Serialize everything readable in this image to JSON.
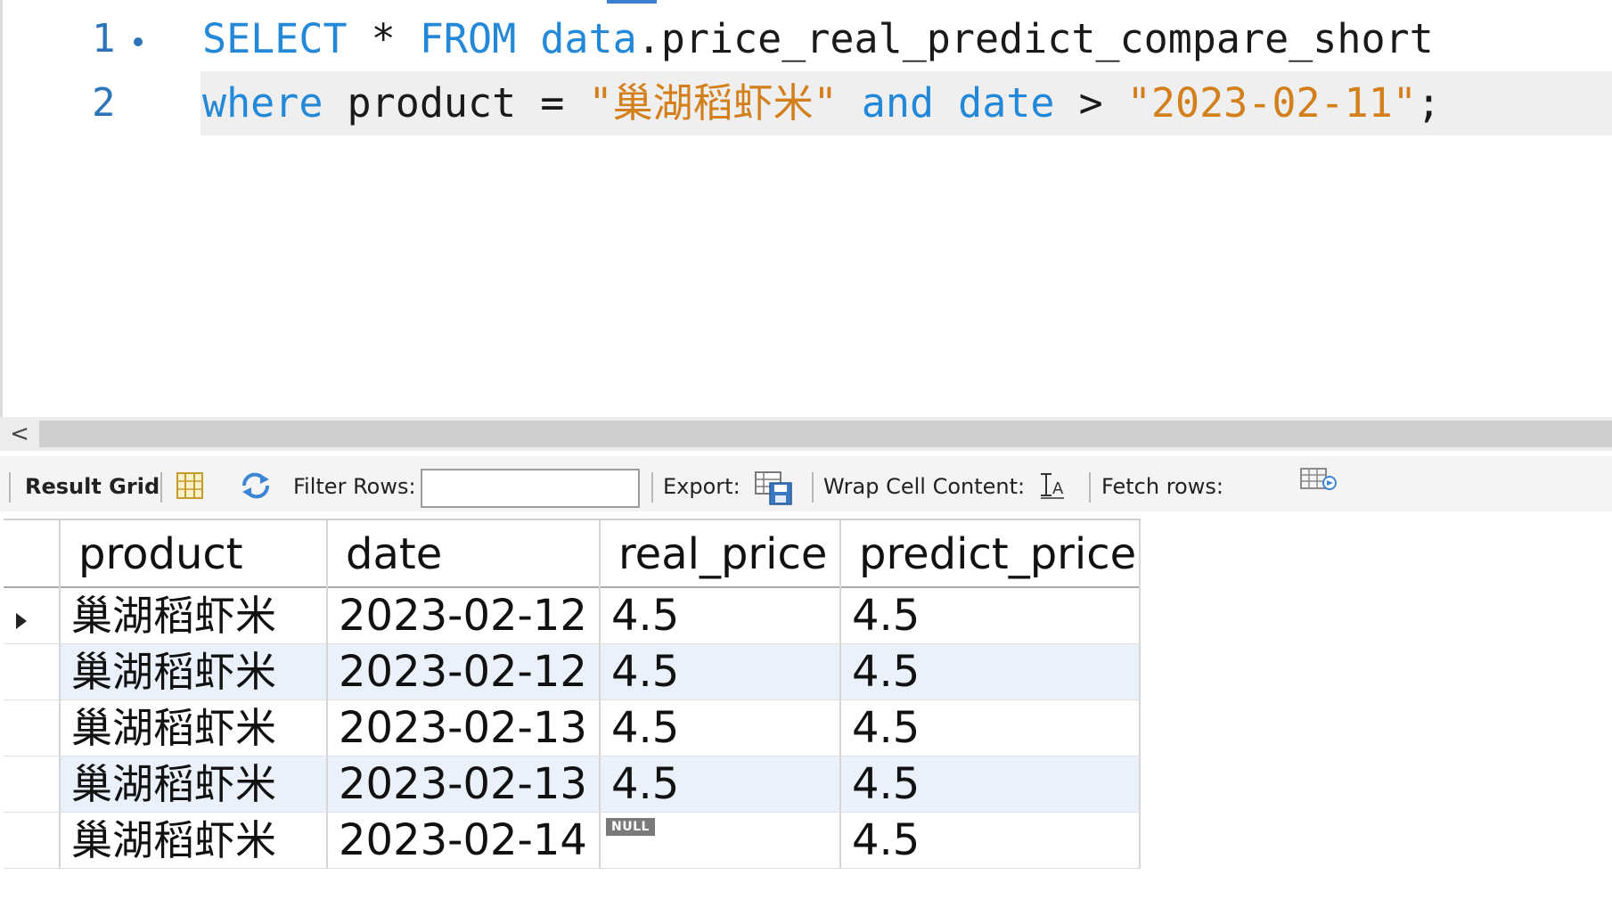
{
  "editor": {
    "lines": [
      {
        "number": "1",
        "tokens": [
          {
            "text": "SELECT",
            "kind": "kw"
          },
          {
            "text": " * ",
            "kind": "plain"
          },
          {
            "text": "FROM",
            "kind": "kw"
          },
          {
            "text": " ",
            "kind": "plain"
          },
          {
            "text": "data",
            "kind": "kw"
          },
          {
            "text": ".price_real_predict_compare_short",
            "kind": "plain"
          }
        ]
      },
      {
        "number": "2",
        "tokens": [
          {
            "text": "where",
            "kind": "kw"
          },
          {
            "text": " product = ",
            "kind": "plain"
          },
          {
            "text": "\"巢湖稻虾米\"",
            "kind": "str"
          },
          {
            "text": " ",
            "kind": "plain"
          },
          {
            "text": "and",
            "kind": "kw"
          },
          {
            "text": " ",
            "kind": "plain"
          },
          {
            "text": "date",
            "kind": "kw"
          },
          {
            "text": " > ",
            "kind": "plain"
          },
          {
            "text": "\"2023-02-11\"",
            "kind": "str"
          },
          {
            "text": ";",
            "kind": "plain"
          }
        ]
      }
    ],
    "colors": {
      "keyword": "#2488d8",
      "string": "#d27f1c",
      "line_number": "#2b75b8"
    }
  },
  "scrollbar": {
    "left_arrow": "<"
  },
  "toolbar": {
    "result_grid_label": "Result Grid",
    "filter_rows_label": "Filter Rows:",
    "filter_rows_value": "",
    "export_label": "Export:",
    "wrap_cell_label": "Wrap Cell Content:",
    "fetch_rows_label": "Fetch rows:",
    "icons": {
      "grid_view": "grid-view-icon",
      "refresh": "refresh-icon",
      "export": "export-icon",
      "wrap": "wrap-cell-icon",
      "fetch": "fetch-rows-icon"
    }
  },
  "grid": {
    "columns": [
      "product",
      "date",
      "real_price",
      "predict_price"
    ],
    "null_label": "NULL",
    "rows": [
      {
        "product": "巢湖稻虾米",
        "date": "2023-02-12",
        "real_price": "4.5",
        "predict_price": "4.5",
        "current": true
      },
      {
        "product": "巢湖稻虾米",
        "date": "2023-02-12",
        "real_price": "4.5",
        "predict_price": "4.5",
        "current": false
      },
      {
        "product": "巢湖稻虾米",
        "date": "2023-02-13",
        "real_price": "4.5",
        "predict_price": "4.5",
        "current": false
      },
      {
        "product": "巢湖稻虾米",
        "date": "2023-02-13",
        "real_price": "4.5",
        "predict_price": "4.5",
        "current": false
      },
      {
        "product": "巢湖稻虾米",
        "date": "2023-02-14",
        "real_price": null,
        "predict_price": "4.5",
        "current": false
      }
    ],
    "colors": {
      "alt_row": "#eaf1fb",
      "null_badge": "#7a7a7a"
    }
  }
}
